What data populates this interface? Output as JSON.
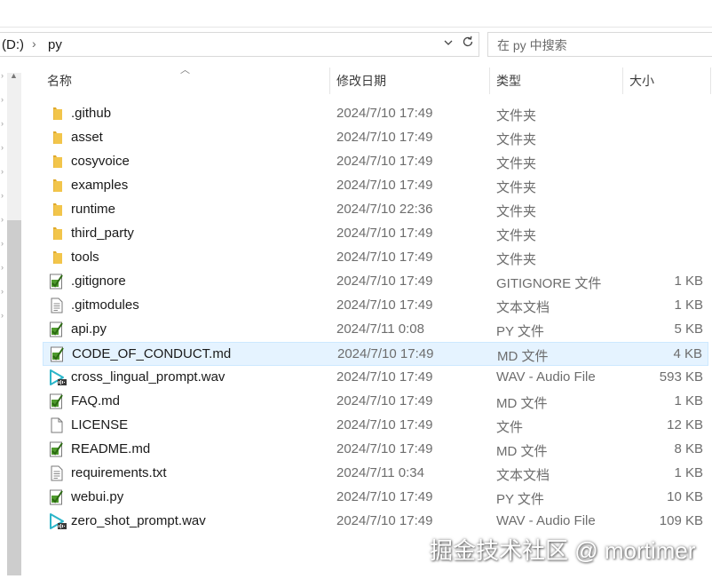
{
  "address": {
    "drive": "(D:)",
    "separator": "›",
    "folder": "py"
  },
  "search": {
    "placeholder": "在 py 中搜索"
  },
  "columns": {
    "name": "名称",
    "date": "修改日期",
    "type": "类型",
    "size": "大小"
  },
  "files": [
    {
      "name": ".github",
      "date": "2024/7/10 17:49",
      "type": "文件夹",
      "size": "",
      "icon": "folder"
    },
    {
      "name": "asset",
      "date": "2024/7/10 17:49",
      "type": "文件夹",
      "size": "",
      "icon": "folder"
    },
    {
      "name": "cosyvoice",
      "date": "2024/7/10 17:49",
      "type": "文件夹",
      "size": "",
      "icon": "folder"
    },
    {
      "name": "examples",
      "date": "2024/7/10 17:49",
      "type": "文件夹",
      "size": "",
      "icon": "folder"
    },
    {
      "name": "runtime",
      "date": "2024/7/10 22:36",
      "type": "文件夹",
      "size": "",
      "icon": "folder"
    },
    {
      "name": "third_party",
      "date": "2024/7/10 17:49",
      "type": "文件夹",
      "size": "",
      "icon": "folder"
    },
    {
      "name": "tools",
      "date": "2024/7/10 17:49",
      "type": "文件夹",
      "size": "",
      "icon": "folder"
    },
    {
      "name": ".gitignore",
      "date": "2024/7/10 17:49",
      "type": "GITIGNORE 文件",
      "size": "1 KB",
      "icon": "editor"
    },
    {
      "name": ".gitmodules",
      "date": "2024/7/10 17:49",
      "type": "文本文档",
      "size": "1 KB",
      "icon": "text"
    },
    {
      "name": "api.py",
      "date": "2024/7/11 0:08",
      "type": "PY 文件",
      "size": "5 KB",
      "icon": "editor"
    },
    {
      "name": "CODE_OF_CONDUCT.md",
      "date": "2024/7/10 17:49",
      "type": "MD 文件",
      "size": "4 KB",
      "icon": "editor"
    },
    {
      "name": "cross_lingual_prompt.wav",
      "date": "2024/7/10 17:49",
      "type": "WAV - Audio File",
      "size": "593 KB",
      "icon": "audio"
    },
    {
      "name": "FAQ.md",
      "date": "2024/7/10 17:49",
      "type": "MD 文件",
      "size": "1 KB",
      "icon": "editor"
    },
    {
      "name": "LICENSE",
      "date": "2024/7/10 17:49",
      "type": "文件",
      "size": "12 KB",
      "icon": "blank"
    },
    {
      "name": "README.md",
      "date": "2024/7/10 17:49",
      "type": "MD 文件",
      "size": "8 KB",
      "icon": "editor"
    },
    {
      "name": "requirements.txt",
      "date": "2024/7/11 0:34",
      "type": "文本文档",
      "size": "1 KB",
      "icon": "text"
    },
    {
      "name": "webui.py",
      "date": "2024/7/10 17:49",
      "type": "PY 文件",
      "size": "10 KB",
      "icon": "editor"
    },
    {
      "name": "zero_shot_prompt.wav",
      "date": "2024/7/10 17:49",
      "type": "WAV - Audio File",
      "size": "109 KB",
      "icon": "audio"
    }
  ],
  "highlighted_row": "CODE_OF_CONDUCT.md",
  "colors": {
    "highlight": "#e5f3ff",
    "folder": "#f2c54b",
    "audio": "#2bb5c9",
    "editor": "#4e9a2d"
  },
  "watermark": "掘金技术社区 @ mortimer"
}
